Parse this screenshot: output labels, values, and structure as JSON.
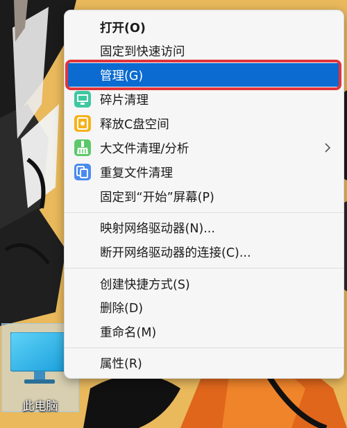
{
  "desktop": {
    "icon_label": "此电脑",
    "icon_name": "this-pc-icon"
  },
  "context_menu": {
    "groups": [
      [
        {
          "label": "打开(O)",
          "bold": true
        },
        {
          "label": "固定到快速访问"
        },
        {
          "label": "管理(G)",
          "highlighted": true
        },
        {
          "label": "碎片清理",
          "icon": "defrag-icon"
        },
        {
          "label": "释放C盘空间",
          "icon": "free-space-icon"
        },
        {
          "label": "大文件清理/分析",
          "icon": "broom-icon",
          "submenu": true
        },
        {
          "label": "重复文件清理",
          "icon": "duplicate-files-icon"
        },
        {
          "label": "固定到“开始”屏幕(P)"
        }
      ],
      [
        {
          "label": "映射网络驱动器(N)..."
        },
        {
          "label": "断开网络驱动器的连接(C)..."
        }
      ],
      [
        {
          "label": "创建快捷方式(S)"
        },
        {
          "label": "删除(D)"
        },
        {
          "label": "重命名(M)"
        }
      ],
      [
        {
          "label": "属性(R)"
        }
      ]
    ]
  },
  "colors": {
    "highlight": "#0b6bd1",
    "highlight_frame": "#e0343b",
    "menu_background": "#f6f6f6"
  }
}
